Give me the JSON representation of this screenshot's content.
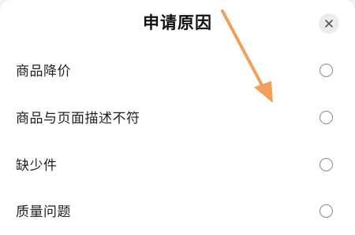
{
  "dialog": {
    "title": "申请原因",
    "close_icon": "close-icon"
  },
  "options": [
    {
      "label": "商品降价"
    },
    {
      "label": "商品与页面描述不符"
    },
    {
      "label": "缺少件"
    },
    {
      "label": "质量问题"
    }
  ],
  "colors": {
    "annotation_arrow": "#f0a05a",
    "radio_border": "#8a8a8a",
    "close_bg": "#ececec"
  }
}
